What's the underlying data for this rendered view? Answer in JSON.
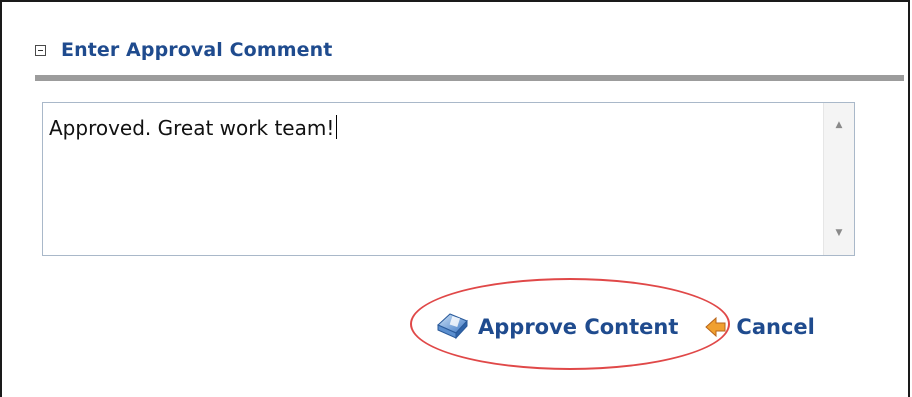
{
  "section": {
    "title": "Enter Approval Comment",
    "collapse_icon": "collapse-minus-icon"
  },
  "comment": {
    "value": "Approved. Great work team!"
  },
  "actions": {
    "approve_label": "Approve Content",
    "approve_icon": "approve-content-icon",
    "cancel_label": "Cancel",
    "cancel_icon": "cancel-arrow-icon"
  },
  "annotation": {
    "highlight_color": "#e04848",
    "highlight_target": "approve-content-button"
  },
  "colors": {
    "link_blue": "#1f4b8e",
    "rule_gray": "#9c9c9c"
  }
}
